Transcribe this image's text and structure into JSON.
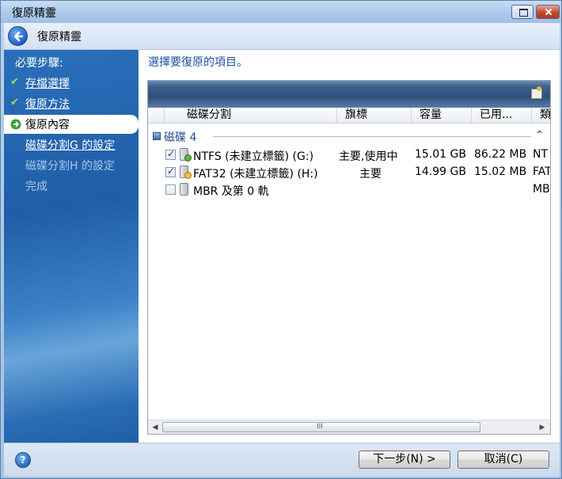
{
  "window": {
    "title": "復原精靈"
  },
  "header": {
    "title": "復原精靈"
  },
  "sidebar": {
    "heading": "必要步驟:",
    "items": [
      {
        "label": "存檔選擇",
        "state": "done"
      },
      {
        "label": "復原方法",
        "state": "done"
      },
      {
        "label": "復原內容",
        "state": "current"
      },
      {
        "label": "磁碟分割G 的設定",
        "state": "link"
      },
      {
        "label": "磁碟分割H 的設定",
        "state": "disabled"
      },
      {
        "label": "完成",
        "state": "disabled"
      }
    ]
  },
  "content": {
    "prompt": "選擇要復原的項目。",
    "columns": [
      "磁碟分割",
      "旗標",
      "容量",
      "已用...",
      "類"
    ],
    "group": "磁碟 4",
    "rows": [
      {
        "checked": true,
        "name": "NTFS (未建立標籤) (G:)",
        "flags": "主要,使用中",
        "capacity": "15.01 GB",
        "used": "86.22 MB",
        "type": "NT"
      },
      {
        "checked": true,
        "name": "FAT32 (未建立標籤) (H:)",
        "flags": "主要",
        "capacity": "14.99 GB",
        "used": "15.02 MB",
        "type": "FAT"
      },
      {
        "checked": false,
        "name": "MBR 及第 0 軌",
        "flags": "",
        "capacity": "",
        "used": "",
        "type": "MB"
      }
    ],
    "scroll_grip": "III"
  },
  "footer": {
    "help": "?",
    "next_label": "下一步(N) >",
    "cancel_label": "取消(C)"
  }
}
